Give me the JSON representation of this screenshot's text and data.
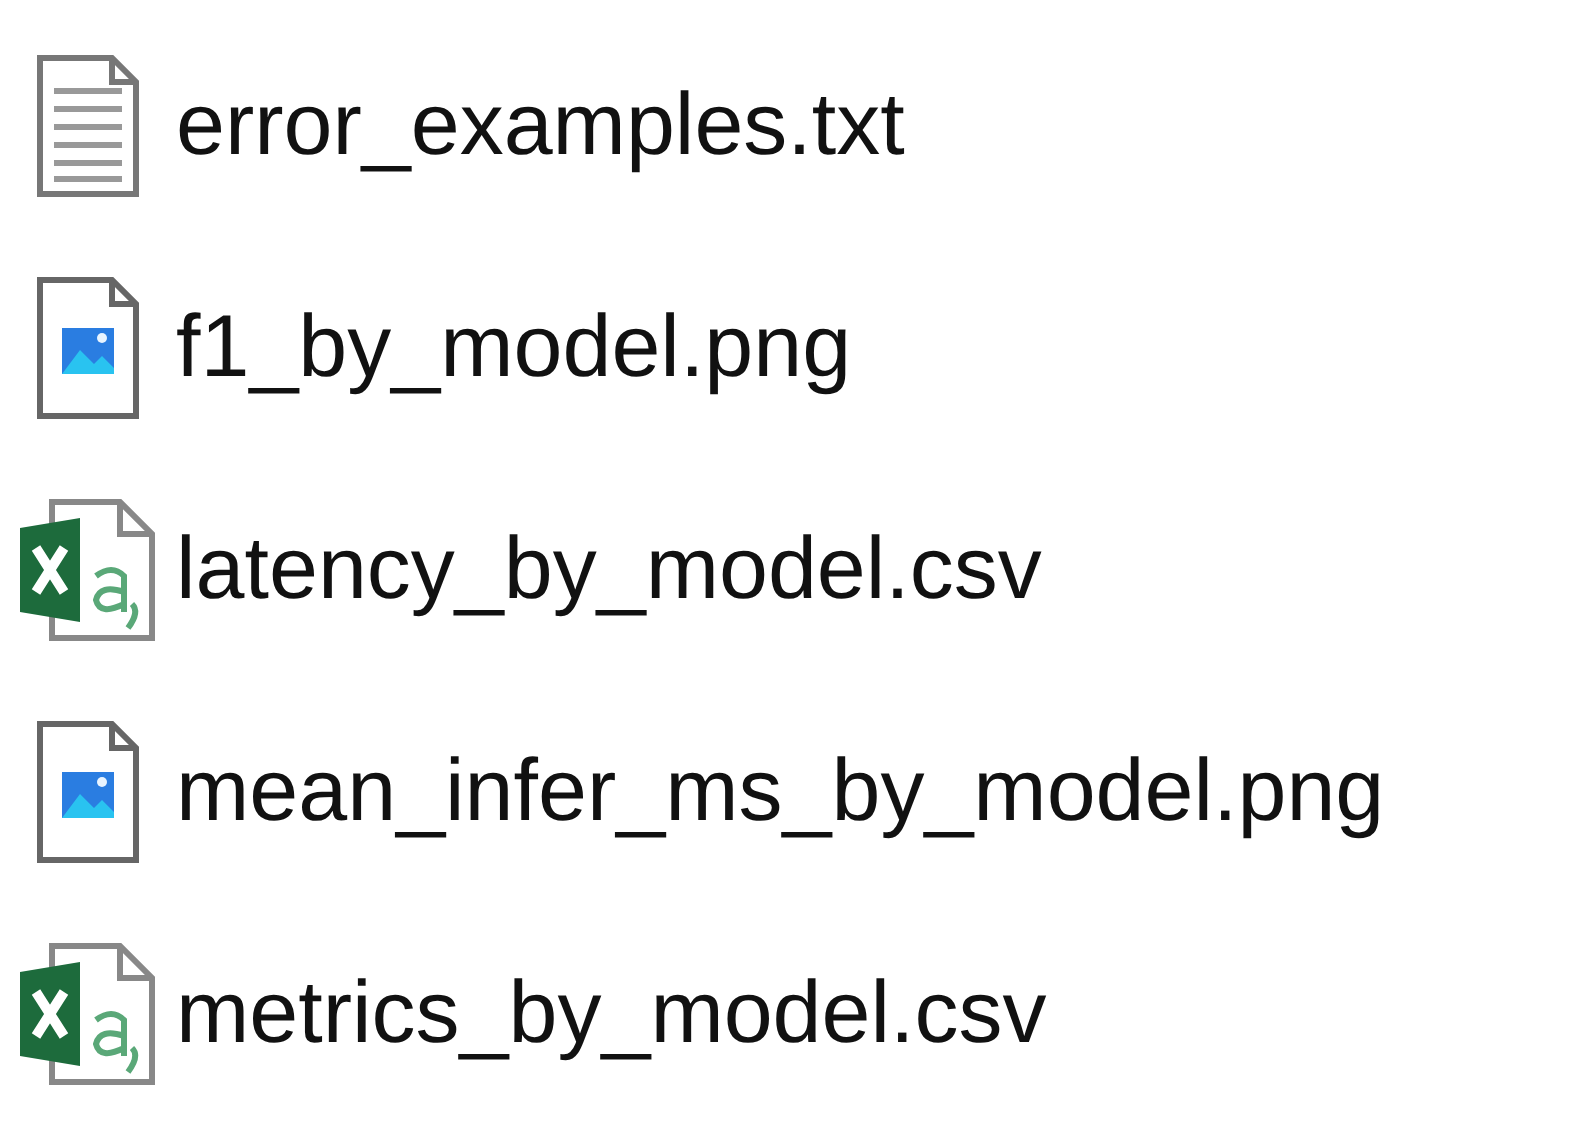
{
  "files": [
    {
      "name": "error_examples.txt",
      "kind": "text"
    },
    {
      "name": "f1_by_model.png",
      "kind": "image"
    },
    {
      "name": "latency_by_model.csv",
      "kind": "spreadsheet"
    },
    {
      "name": "mean_infer_ms_by_model.png",
      "kind": "image"
    },
    {
      "name": "metrics_by_model.csv",
      "kind": "spreadsheet"
    }
  ]
}
